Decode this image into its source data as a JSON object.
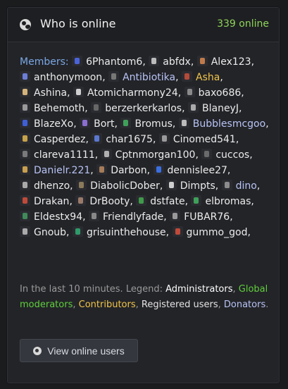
{
  "widget": {
    "title": "Who is online",
    "online_count": "339 online",
    "members_label": "Members:",
    "button_label": "View online users"
  },
  "members": [
    {
      "name": "6Phantom6",
      "type": "registered",
      "avatar": "#4a63d8"
    },
    {
      "name": "abfdx",
      "type": "registered",
      "avatar": "#bbbbbb"
    },
    {
      "name": "Alex123",
      "type": "registered",
      "avatar": "#c07a4a"
    },
    {
      "name": "anthonymoon",
      "type": "registered",
      "avatar": "#6c7ed6"
    },
    {
      "name": "Antibiotika",
      "type": "donator",
      "avatar": "#777777"
    },
    {
      "name": "Asha",
      "type": "contributor",
      "avatar": "#b34a3a"
    },
    {
      "name": "Ashina",
      "type": "registered",
      "avatar": "#d4b37a"
    },
    {
      "name": "Atomicharmony24",
      "type": "registered",
      "avatar": "#cfcfcf"
    },
    {
      "name": "baxo686",
      "type": "registered",
      "avatar": "#8a8a8a"
    },
    {
      "name": "Behemoth",
      "type": "registered",
      "avatar": "#999999"
    },
    {
      "name": "berzerkerkarlos",
      "type": "registered",
      "avatar": "#666666"
    },
    {
      "name": "BlaneyJ",
      "type": "registered",
      "avatar": "#aaaaaa"
    },
    {
      "name": "BlazeXo",
      "type": "registered",
      "avatar": "#3f5fd6"
    },
    {
      "name": "Bort",
      "type": "registered",
      "avatar": "#8a6fd0"
    },
    {
      "name": "Bromus",
      "type": "registered",
      "avatar": "#3fa05a"
    },
    {
      "name": "Bubblesmcgoo",
      "type": "donator",
      "avatar": "#bbbbbb"
    },
    {
      "name": "Casperdez",
      "type": "registered",
      "avatar": "#c7a34a"
    },
    {
      "name": "char1675",
      "type": "registered",
      "avatar": "#5a78d0"
    },
    {
      "name": "Cinomed541",
      "type": "registered",
      "avatar": "#9a9a9a"
    },
    {
      "name": "clareva1111",
      "type": "registered",
      "avatar": "#7a7a7a"
    },
    {
      "name": "Cptnmorgan100",
      "type": "registered",
      "avatar": "#b0b0b0"
    },
    {
      "name": "cuccos",
      "type": "registered",
      "avatar": "#6a6a6a"
    },
    {
      "name": "Danielr.221",
      "type": "donator",
      "avatar": "#c8a050"
    },
    {
      "name": "Darbon",
      "type": "registered",
      "avatar": "#a67c5a"
    },
    {
      "name": "dennislee27",
      "type": "registered",
      "avatar": "#3a6fe0"
    },
    {
      "name": "dhenzo",
      "type": "registered",
      "avatar": "#aaaaaa"
    },
    {
      "name": "DiabolicDober",
      "type": "registered",
      "avatar": "#8a7a5a"
    },
    {
      "name": "Dimpts",
      "type": "registered",
      "avatar": "#cfcfcf"
    },
    {
      "name": "dino",
      "type": "donator",
      "avatar": "#8c8c8c"
    },
    {
      "name": "Drakan",
      "type": "registered",
      "avatar": "#c04a3a"
    },
    {
      "name": "DrBooty",
      "type": "registered",
      "avatar": "#9a7a6a"
    },
    {
      "name": "dstfate",
      "type": "registered",
      "avatar": "#3f9a4a"
    },
    {
      "name": "elbromas",
      "type": "registered",
      "avatar": "#3fa05a"
    },
    {
      "name": "Eldestx94",
      "type": "registered",
      "avatar": "#3f8a5a"
    },
    {
      "name": "Friendlyfade",
      "type": "registered",
      "avatar": "#888888"
    },
    {
      "name": "FUBAR76",
      "type": "registered",
      "avatar": "#999999"
    },
    {
      "name": "Gnoub",
      "type": "registered",
      "avatar": "#aaaaaa"
    },
    {
      "name": "grisuinthehouse",
      "type": "registered",
      "avatar": "#2f9a6a"
    },
    {
      "name": "gummo_god",
      "type": "registered",
      "avatar": "#c04a3a"
    }
  ],
  "legend": {
    "prefix": "In the last 10 minutes. Legend: ",
    "administrators": "Administrators",
    "global_moderators": "Global moderators",
    "contributors": "Contributors",
    "registered": "Registered users",
    "donators": "Donators"
  }
}
